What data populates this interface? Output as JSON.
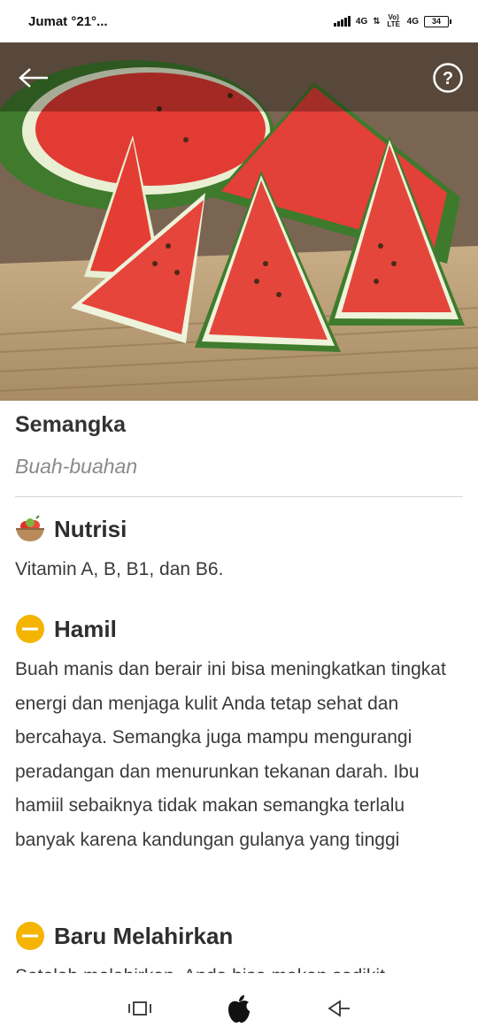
{
  "status_bar": {
    "left_text": "Jumat °21°...",
    "network_1": "4G",
    "network_2": "4G",
    "volte_label": "Vo) LTE",
    "battery_level": "34"
  },
  "header": {
    "back_icon": "arrow-left-icon",
    "help_icon": "question-circle-icon"
  },
  "food": {
    "name": "Semangka",
    "category": "Buah-buahan"
  },
  "sections": {
    "nutrition": {
      "title": "Nutrisi",
      "icon": "fruit-bowl-icon",
      "text": "Vitamin A, B, B1, dan B6."
    },
    "pregnant": {
      "title": "Hamil",
      "icon": "minus-circle-icon",
      "status_color": "#f4b400",
      "text": "Buah manis dan berair ini bisa meningkatkan tingkat energi dan menjaga kulit Anda tetap sehat dan bercahaya. Semangka juga mampu mengurangi peradangan dan menurunkan tekanan darah. Ibu hamiil sebaiknya tidak makan semangka terlalu banyak karena kandungan gulanya yang tinggi"
    },
    "postpartum": {
      "title": "Baru Melahirkan",
      "icon": "minus-circle-icon",
      "status_color": "#f4b400",
      "text": "Setelah melahirkan, Anda bisa makan sedikit"
    }
  },
  "nav_bar": {
    "recents_icon": "recent-apps-icon",
    "home_icon": "apple-home-icon",
    "back_icon": "back-triangle-icon"
  }
}
